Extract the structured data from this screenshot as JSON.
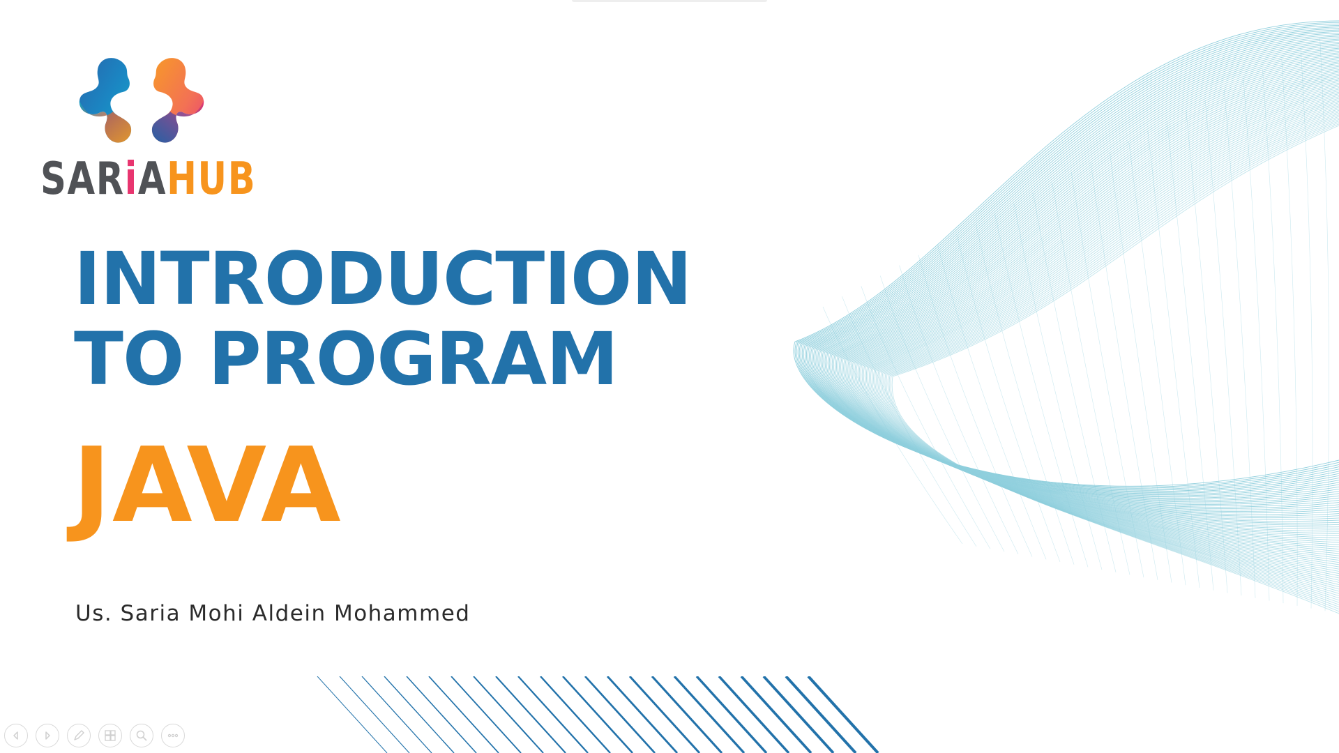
{
  "slide": {
    "logo": {
      "word_part1": "SAR",
      "word_part2": "i",
      "word_part3": "A",
      "word_part4": "HUB",
      "colors": {
        "grey": "#505256",
        "pink": "#e8356f",
        "orange": "#f7941d",
        "blue": "#1c5fa8",
        "teal": "#0aa4c8"
      }
    },
    "title_line1": "INTRODUCTION",
    "title_line2": "TO PROGRAM",
    "subject": "JAVA",
    "author": "Us. Saria Mohi Aldein Mohammed",
    "colors": {
      "title": "#2272aa",
      "subject": "#f7941d",
      "author": "#2b2b2b",
      "wave": "#8fcfdd",
      "stripes": "#2272aa"
    }
  },
  "controls": [
    {
      "name": "previous-slide",
      "icon": "arrow-left-icon"
    },
    {
      "name": "next-slide",
      "icon": "arrow-right-icon"
    },
    {
      "name": "pen",
      "icon": "pen-icon"
    },
    {
      "name": "see-all-slides",
      "icon": "slides-grid-icon"
    },
    {
      "name": "zoom",
      "icon": "magnifier-icon"
    },
    {
      "name": "more-options",
      "icon": "ellipsis-icon"
    }
  ]
}
